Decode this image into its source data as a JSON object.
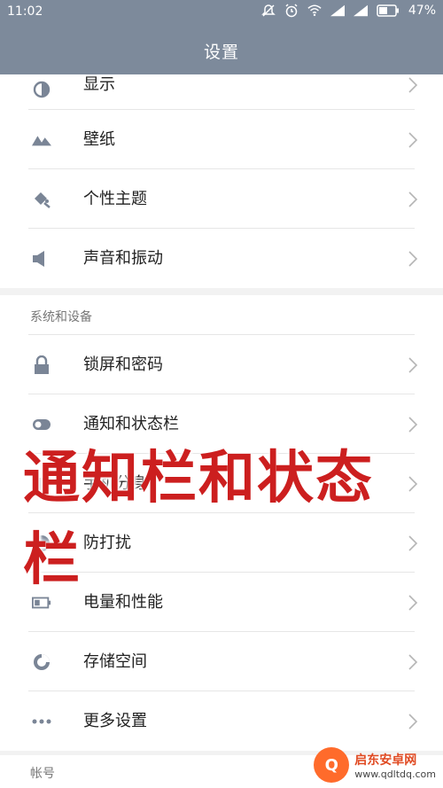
{
  "status_bar": {
    "time": "11:02",
    "battery": "47%",
    "icons": [
      "mute-icon",
      "alarm-icon",
      "wifi-icon",
      "signal-icon",
      "signal-icon",
      "battery-icon"
    ]
  },
  "header": {
    "title": "设置"
  },
  "sections": {
    "top": [
      {
        "label": "显示",
        "icon": "display-icon"
      },
      {
        "label": "壁纸",
        "icon": "wallpaper-icon"
      },
      {
        "label": "个性主题",
        "icon": "theme-icon"
      },
      {
        "label": "声音和振动",
        "icon": "sound-icon"
      }
    ],
    "system": {
      "title": "系统和设备",
      "items": [
        {
          "label": "锁屏和密码",
          "icon": "lock-icon"
        },
        {
          "label": "通知和状态栏",
          "icon": "toggle-icon"
        },
        {
          "label": "手机分身",
          "icon": "split-icon"
        },
        {
          "label": "防打扰",
          "icon": "dnd-icon"
        },
        {
          "label": "电量和性能",
          "icon": "battery-icon"
        },
        {
          "label": "存储空间",
          "icon": "storage-icon"
        },
        {
          "label": "更多设置",
          "icon": "more-icon"
        }
      ]
    },
    "account": {
      "title": "帐号"
    }
  },
  "overlay": {
    "text": "通知栏和状态栏"
  },
  "watermark": {
    "name": "启东安卓网",
    "url": "www.qdltdq.com",
    "badge": "Q"
  },
  "colors": {
    "header_bg": "#7d8a9b",
    "overlay_text": "#cc1f1f"
  }
}
